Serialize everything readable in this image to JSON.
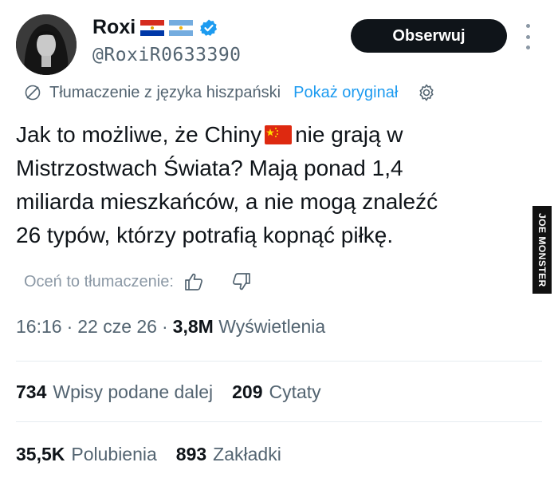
{
  "user": {
    "name": "Roxi",
    "handle": "@RoxiR0633390",
    "follow_label": "Obserwuj",
    "flags": [
      "flag-paraguay-icon",
      "flag-argentina-icon"
    ],
    "verified_icon": "verified-badge-icon"
  },
  "translation": {
    "label": "Tłumaczenie z języka hiszpański",
    "show_original": "Pokaż oryginał"
  },
  "tweet": {
    "line1a": "Jak to możliwe, że Chiny",
    "line1b": "nie grają w",
    "line2": "Mistrzostwach Świata? Mają ponad 1,4",
    "line3": "miliarda mieszkańców, a nie mogą znaleźć",
    "line4": "26 typów, którzy potrafią kopnąć piłkę."
  },
  "rate": {
    "label": "Oceń to tłumaczenie:"
  },
  "meta": {
    "time": "16:16",
    "date": "22 cze 26",
    "views_count": "3,8M",
    "views_label": "Wyświetlenia"
  },
  "stats": {
    "retweets_count": "734",
    "retweets_label": "Wpisy podane dalej",
    "quotes_count": "209",
    "quotes_label": "Cytaty",
    "likes_count": "35,5K",
    "likes_label": "Polubienia",
    "bookmarks_count": "893",
    "bookmarks_label": "Zakładki"
  },
  "watermark": "JOE MONSTER",
  "colors": {
    "link": "#1d9bf0",
    "muted": "#536471",
    "text": "#0f1419",
    "button": "#0f1419"
  }
}
